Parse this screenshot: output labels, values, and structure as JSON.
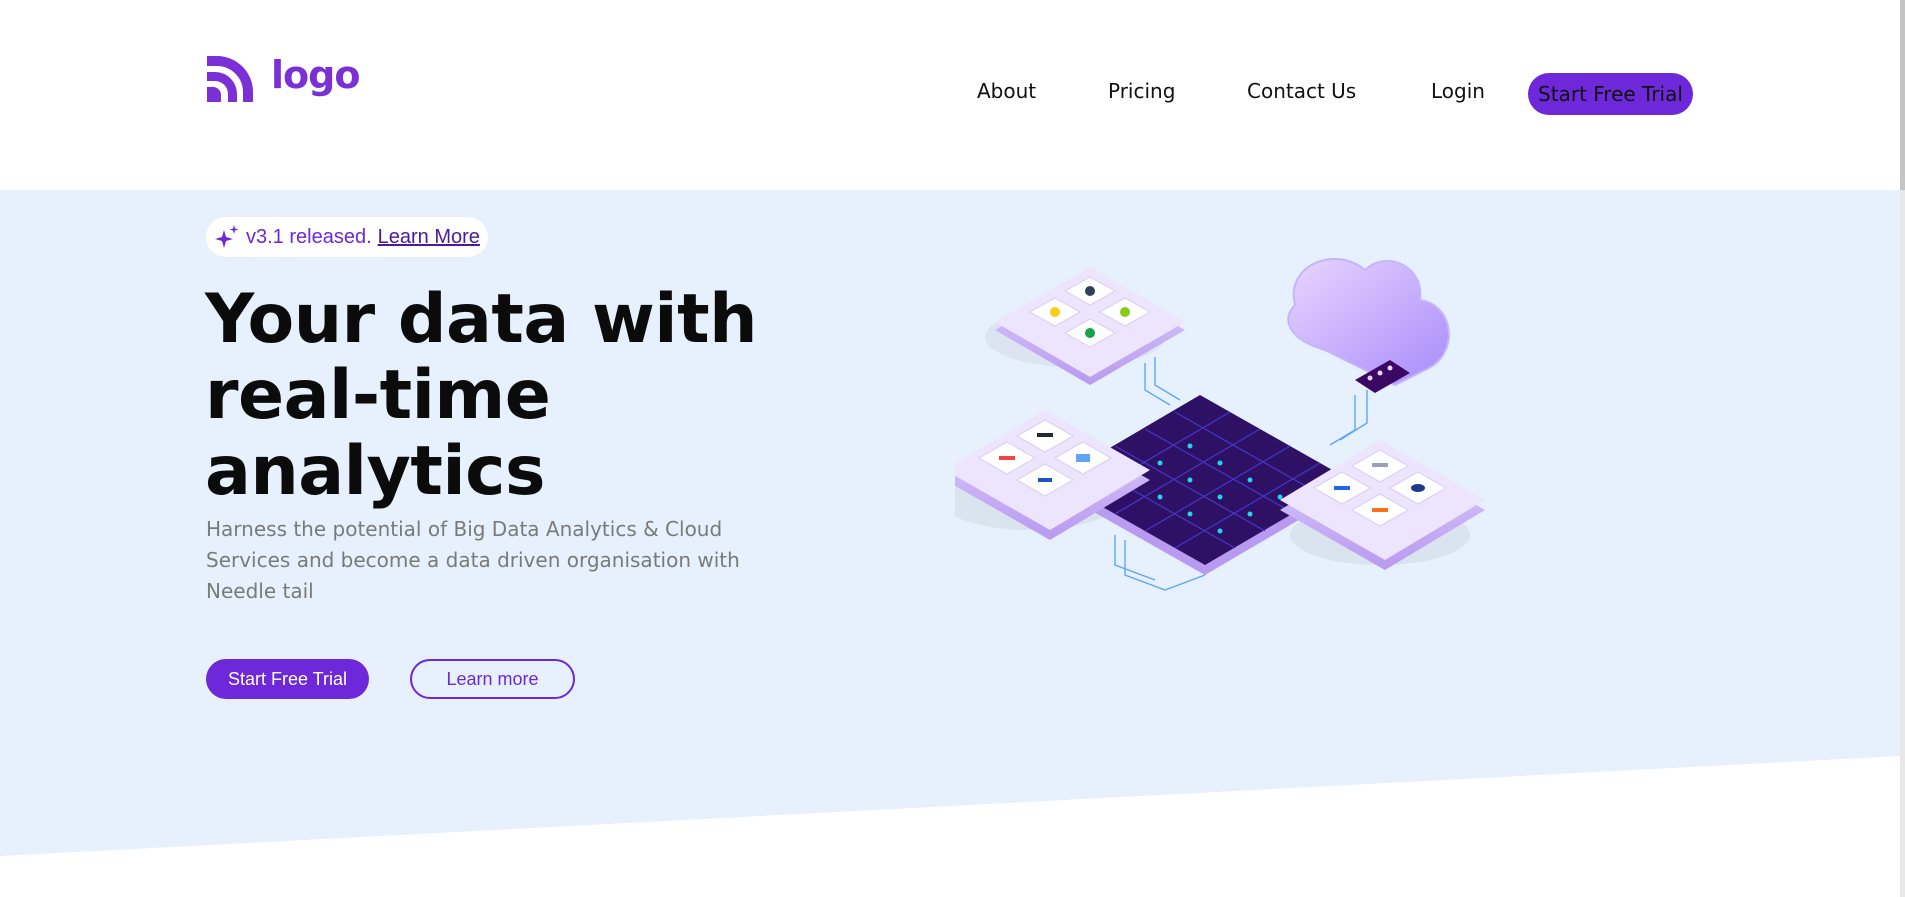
{
  "header": {
    "logo_text": "logo",
    "logo_icon": "signal-arcs-icon",
    "nav": {
      "about": "About",
      "pricing": "Pricing",
      "contact": "Contact Us",
      "login": "Login"
    },
    "cta_label": "Start Free Trial"
  },
  "hero": {
    "release": {
      "icon": "sparkle-icon",
      "text": "v3.1 released.",
      "link": "Learn More"
    },
    "title": "Your data with real-time analytics",
    "subtitle": "Harness the potential of Big Data Analytics & Cloud Services and become a data driven organisation with Needle tail",
    "primary_cta": "Start Free Trial",
    "secondary_cta": "Learn more",
    "illustration": "isometric-data-cloud-illustration"
  },
  "colors": {
    "accent": "#6d28d9",
    "hero_background": "#e6f1fd",
    "title": "#0b0b0b",
    "subtitle": "#7a7a7a"
  }
}
